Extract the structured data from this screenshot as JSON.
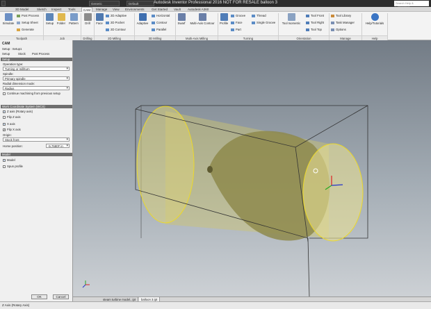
{
  "window": {
    "title": "Autodesk Inventor Professional 2016   NOT FOR RESALE   balloon 3",
    "qa_appearance": "Generic",
    "qa_material": "Default",
    "search_placeholder": "Search Help & Commands"
  },
  "tabs": [
    "3D Model",
    "Sketch",
    "Inspect",
    "Tools",
    "CAM",
    "Manage",
    "View",
    "Environments",
    "Get Started",
    "Vault",
    "Autodesk A360"
  ],
  "active_tab": "CAM",
  "ribbon": {
    "toolpath": {
      "simulate": "Simulate",
      "post_process": "Post Process",
      "setup_sheet": "Setup Sheet",
      "generate": "Generate",
      "group": "Toolpath"
    },
    "job": {
      "setup": "Setup",
      "folder": "Folder",
      "pattern": "Pattern",
      "group": "Job"
    },
    "drilling": {
      "drill": "Drill",
      "group": "Drilling"
    },
    "milling2d": {
      "face": "Face",
      "adaptive2d": "2D Adaptive",
      "pocket2d": "2D Pocket",
      "contour2d": "2D Contour",
      "group": "2D Milling"
    },
    "milling3d": {
      "adaptive": "Adaptive",
      "horizontal": "Horizontal",
      "contour": "Contour",
      "parallel": "Parallel",
      "group": "3D Milling"
    },
    "multiaxis": {
      "swarf": "Swarf",
      "multiaxis_contour": "Multi-Axis Contour",
      "group": "Multi-Axis Milling"
    },
    "turning": {
      "profile": "Profile",
      "groove": "Groove",
      "face": "Face",
      "part": "Part",
      "thread": "Thread",
      "single_groove": "Single Groove",
      "group": "Turning"
    },
    "orientation": {
      "tool_isometric": "Tool Isometric",
      "tool_front": "Tool Front",
      "tool_right": "Tool Right",
      "tool_top": "Tool Top",
      "group": "Orientation"
    },
    "manage": {
      "tool_library": "Tool Library",
      "task_manager": "Task Manager",
      "options": "Options",
      "group": "Manage"
    },
    "help": {
      "help_tutorials": "Help/Tutorials",
      "group": "Help"
    }
  },
  "panel": {
    "title": "CAM",
    "breadcrumb": "Setup : Setup1",
    "subtabs": [
      "Setup",
      "Stock",
      "Post Process"
    ],
    "setup_section": "Setup",
    "operation_type_label": "Operation type:",
    "operation_type": "Turning or mill/turn",
    "spindle_label": "Spindle:",
    "spindle": "Primary spindle",
    "radial_mode_label": "Radial dimension mode:",
    "radial_mode": "Radius",
    "continue_label": "Continue machining from previous setup",
    "wcs_section": "Work Coordinate System (WCS)",
    "z_axis": "Z axis (Rotary axis)",
    "flip_z": "Flip Z axis",
    "x_axis": "X axis",
    "flip_x": "Flip X axis",
    "origin_label": "Origin:",
    "origin": "Stock front",
    "home_label": "Home position:",
    "home_value": "-5.7680F in",
    "model_section": "Model",
    "model": "Model",
    "spun_profile": "Spun profile",
    "ok": "OK",
    "cancel": "Cancel"
  },
  "doc_tabs": [
    "steam turbine model...ipt",
    "balloon 3.ipt"
  ],
  "active_doc": "balloon 3.ipt",
  "status": "Z Axis (Rotary Axis)"
}
